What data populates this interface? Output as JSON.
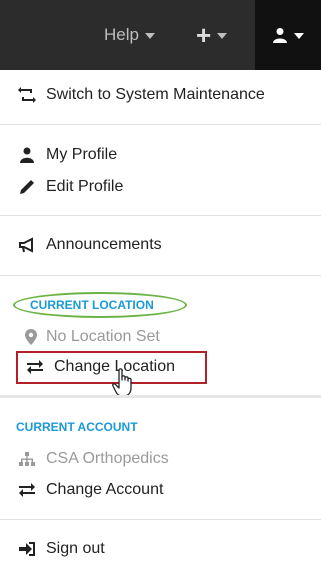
{
  "topbar": {
    "help_label": "Help",
    "plus_icon": "plus-icon",
    "user_icon": "user-icon"
  },
  "menu": {
    "switch_system": "Switch to System Maintenance",
    "my_profile": "My Profile",
    "edit_profile": "Edit Profile",
    "announcements": "Announcements",
    "current_location_header": "CURRENT LOCATION",
    "no_location": "No Location Set",
    "change_location": "Change Location",
    "current_account_header": "CURRENT ACCOUNT",
    "account_name": "CSA Orthopedics",
    "change_account": "Change Account",
    "sign_out": "Sign out"
  },
  "colors": {
    "topbar_bg": "#2c2c2c",
    "header_blue": "#1a9ad6",
    "highlight_green": "#6ab344",
    "highlight_red": "#b3202a"
  }
}
